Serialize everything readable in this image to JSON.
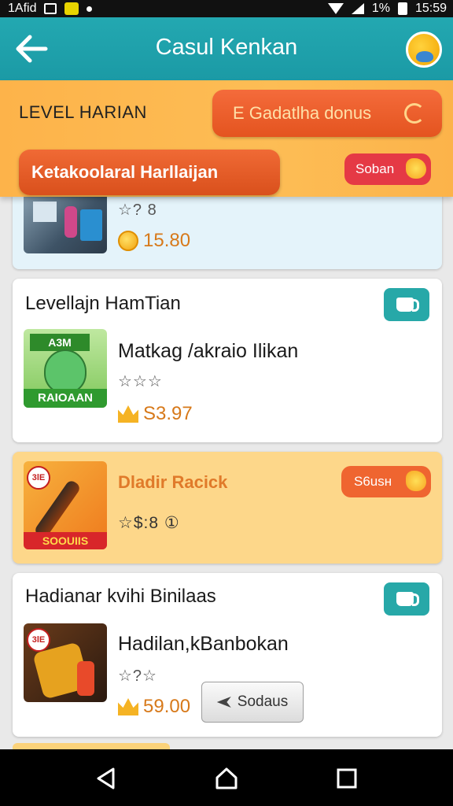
{
  "statusbar": {
    "carrier": "1Afid",
    "time": "15:59",
    "battery": "1%"
  },
  "appbar": {
    "title": "Casul Kenkan"
  },
  "banner": {
    "level_label": "LEVEL HARIAN",
    "top_pill": "E Gadatlha donus",
    "main_pill": "Ketakoolaral Harllaijan",
    "small_pill": "Soban"
  },
  "cards": [
    {
      "stars": "☆? 8",
      "price": "15.80",
      "tint": "blue"
    },
    {
      "title": "Levellajn HamTian",
      "thumb_label_top": "A3M",
      "thumb_label_bottom": "RAIOAAN",
      "item_name": "Matkag /akraio Ilikan",
      "stars": "☆☆☆",
      "price": "S3.97"
    },
    {
      "title": "Dladir Racick",
      "pill": "S6usн",
      "badge": "3lЕ",
      "thumb_label_bottom": "SOOUIIS",
      "stars": "☆$:8 ①",
      "tint": "yellow"
    },
    {
      "title": "Hadianar kvihi Binilaas",
      "badge": "3lЕ",
      "item_name": "Hadilan,kBanbokan",
      "stars": "☆?☆",
      "price": "59.00",
      "button": "Sodaus"
    }
  ],
  "colors": {
    "appbar": "#1b9aa5",
    "banner": "#fdb34a",
    "accent_orange": "#ef6530",
    "teal_button": "#27a8a8"
  },
  "icons": [
    "back-arrow-icon",
    "avatar-icon",
    "moon-icon",
    "sparkle-icon",
    "coin-icon",
    "crown-icon",
    "teapot-icon",
    "nav-back-icon",
    "nav-home-icon",
    "nav-recents-icon"
  ]
}
